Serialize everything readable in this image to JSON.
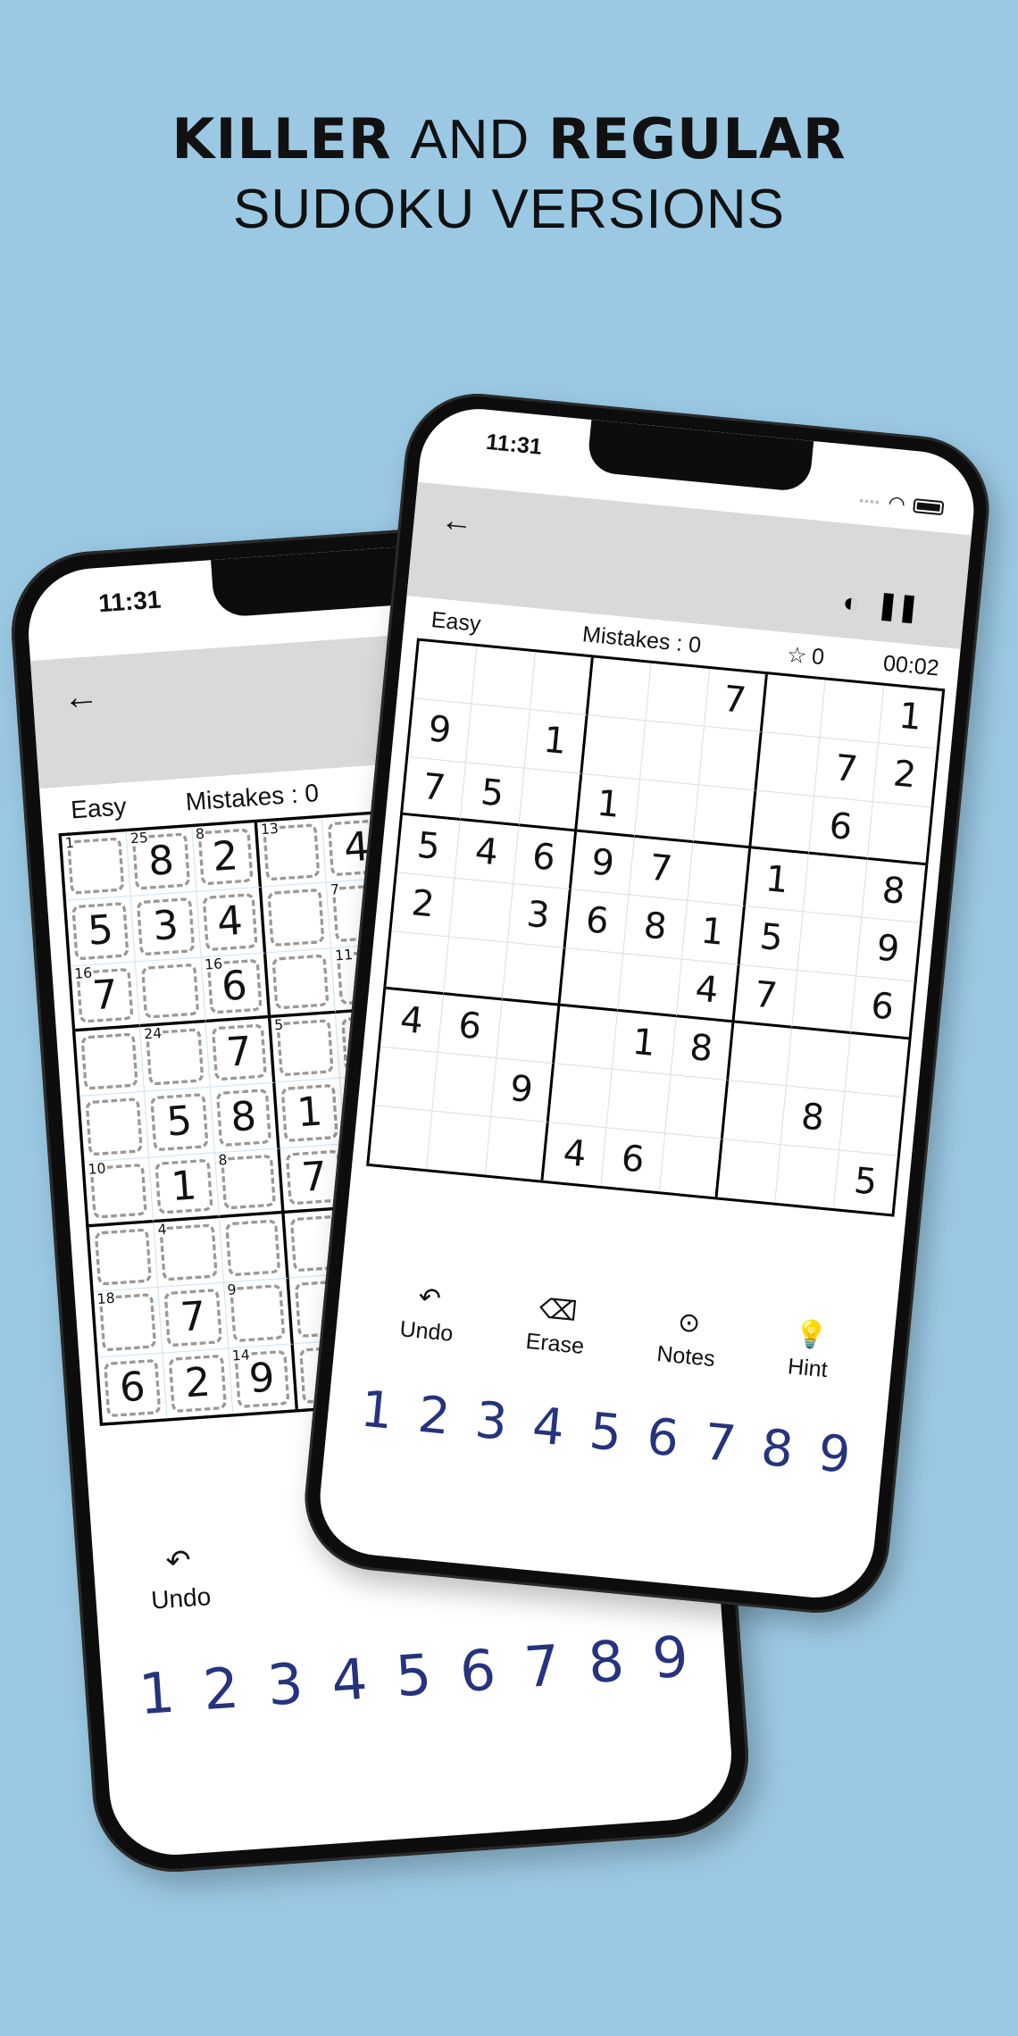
{
  "headline": {
    "line1_bold_a": "KILLER",
    "line1_light": "AND",
    "line1_bold_b": "REGULAR",
    "line2": "SUDOKU VERSIONS"
  },
  "colors": {
    "background": "#9bc9e4",
    "number_pad": "#26337d",
    "appbar": "#d9d9d9"
  },
  "back_phone": {
    "status_time": "11:31",
    "difficulty": "Easy",
    "mistakes": "Mistakes : 0",
    "undo_label": "Undo",
    "numbers": [
      "1",
      "2",
      "3",
      "4",
      "5",
      "6",
      "7",
      "8",
      "9"
    ],
    "grid": [
      [
        "",
        "8",
        "2",
        "",
        "4",
        "",
        "",
        "",
        ""
      ],
      [
        "5",
        "3",
        "4",
        "",
        "",
        "",
        "",
        "",
        ""
      ],
      [
        "7",
        "",
        "6",
        "",
        "",
        "",
        "",
        "",
        ""
      ],
      [
        "",
        "",
        "7",
        "",
        "",
        "",
        "",
        "",
        ""
      ],
      [
        "",
        "5",
        "8",
        "1",
        "",
        "",
        "",
        "",
        ""
      ],
      [
        "",
        "1",
        "",
        "7",
        "",
        "",
        "",
        "",
        ""
      ],
      [
        "",
        "",
        "",
        "",
        "",
        "",
        "",
        "",
        ""
      ],
      [
        "",
        "7",
        "",
        "",
        "",
        "",
        "",
        "",
        ""
      ],
      [
        "6",
        "2",
        "9",
        "",
        "",
        "",
        "",
        "",
        ""
      ]
    ],
    "cages": [
      [
        "1",
        "25",
        "8",
        "13",
        "",
        "",
        "",
        "",
        ""
      ],
      [
        "",
        "",
        "",
        "",
        "7",
        "",
        "",
        "",
        ""
      ],
      [
        "16",
        "",
        "16",
        "",
        "11",
        "",
        "",
        "",
        ""
      ],
      [
        "",
        "24",
        "",
        "5",
        "",
        "",
        "",
        "",
        ""
      ],
      [
        "",
        "",
        "",
        "",
        "",
        "",
        "",
        "",
        ""
      ],
      [
        "10",
        "",
        "8",
        "",
        "",
        "",
        "",
        "",
        ""
      ],
      [
        "",
        "4",
        "",
        "",
        "",
        "",
        "",
        "",
        ""
      ],
      [
        "18",
        "",
        "9",
        "",
        "",
        "",
        "",
        "",
        ""
      ],
      [
        "",
        "",
        "14",
        "",
        "",
        "",
        "",
        "",
        ""
      ]
    ]
  },
  "front_phone": {
    "status_time": "11:31",
    "difficulty": "Easy",
    "mistakes": "Mistakes : 0",
    "stars": "0",
    "timer": "00:02",
    "tools": [
      {
        "label": "Undo",
        "icon": "undo-icon"
      },
      {
        "label": "Erase",
        "icon": "erase-icon"
      },
      {
        "label": "Notes",
        "icon": "notes-toggle-icon"
      },
      {
        "label": "Hint",
        "icon": "hint-bulb-icon"
      }
    ],
    "numbers": [
      "1",
      "2",
      "3",
      "4",
      "5",
      "6",
      "7",
      "8",
      "9"
    ],
    "grid": [
      [
        "",
        "",
        "",
        "",
        "",
        "7",
        "",
        "",
        "1"
      ],
      [
        "9",
        "",
        "1",
        "",
        "",
        "",
        "",
        "7",
        "2"
      ],
      [
        "7",
        "5",
        "",
        "1",
        "",
        "",
        "",
        "6",
        ""
      ],
      [
        "5",
        "4",
        "6",
        "9",
        "7",
        "",
        "1",
        "",
        "8"
      ],
      [
        "2",
        "",
        "3",
        "6",
        "8",
        "1",
        "5",
        "",
        "9"
      ],
      [
        "",
        "",
        "",
        "",
        "",
        "4",
        "7",
        "",
        "6"
      ],
      [
        "4",
        "6",
        "",
        "",
        "1",
        "8",
        "",
        "",
        ""
      ],
      [
        "",
        "",
        "9",
        "",
        "",
        "",
        "",
        "8",
        ""
      ],
      [
        "",
        "",
        "",
        "4",
        "6",
        "",
        "",
        "",
        "5"
      ]
    ]
  }
}
